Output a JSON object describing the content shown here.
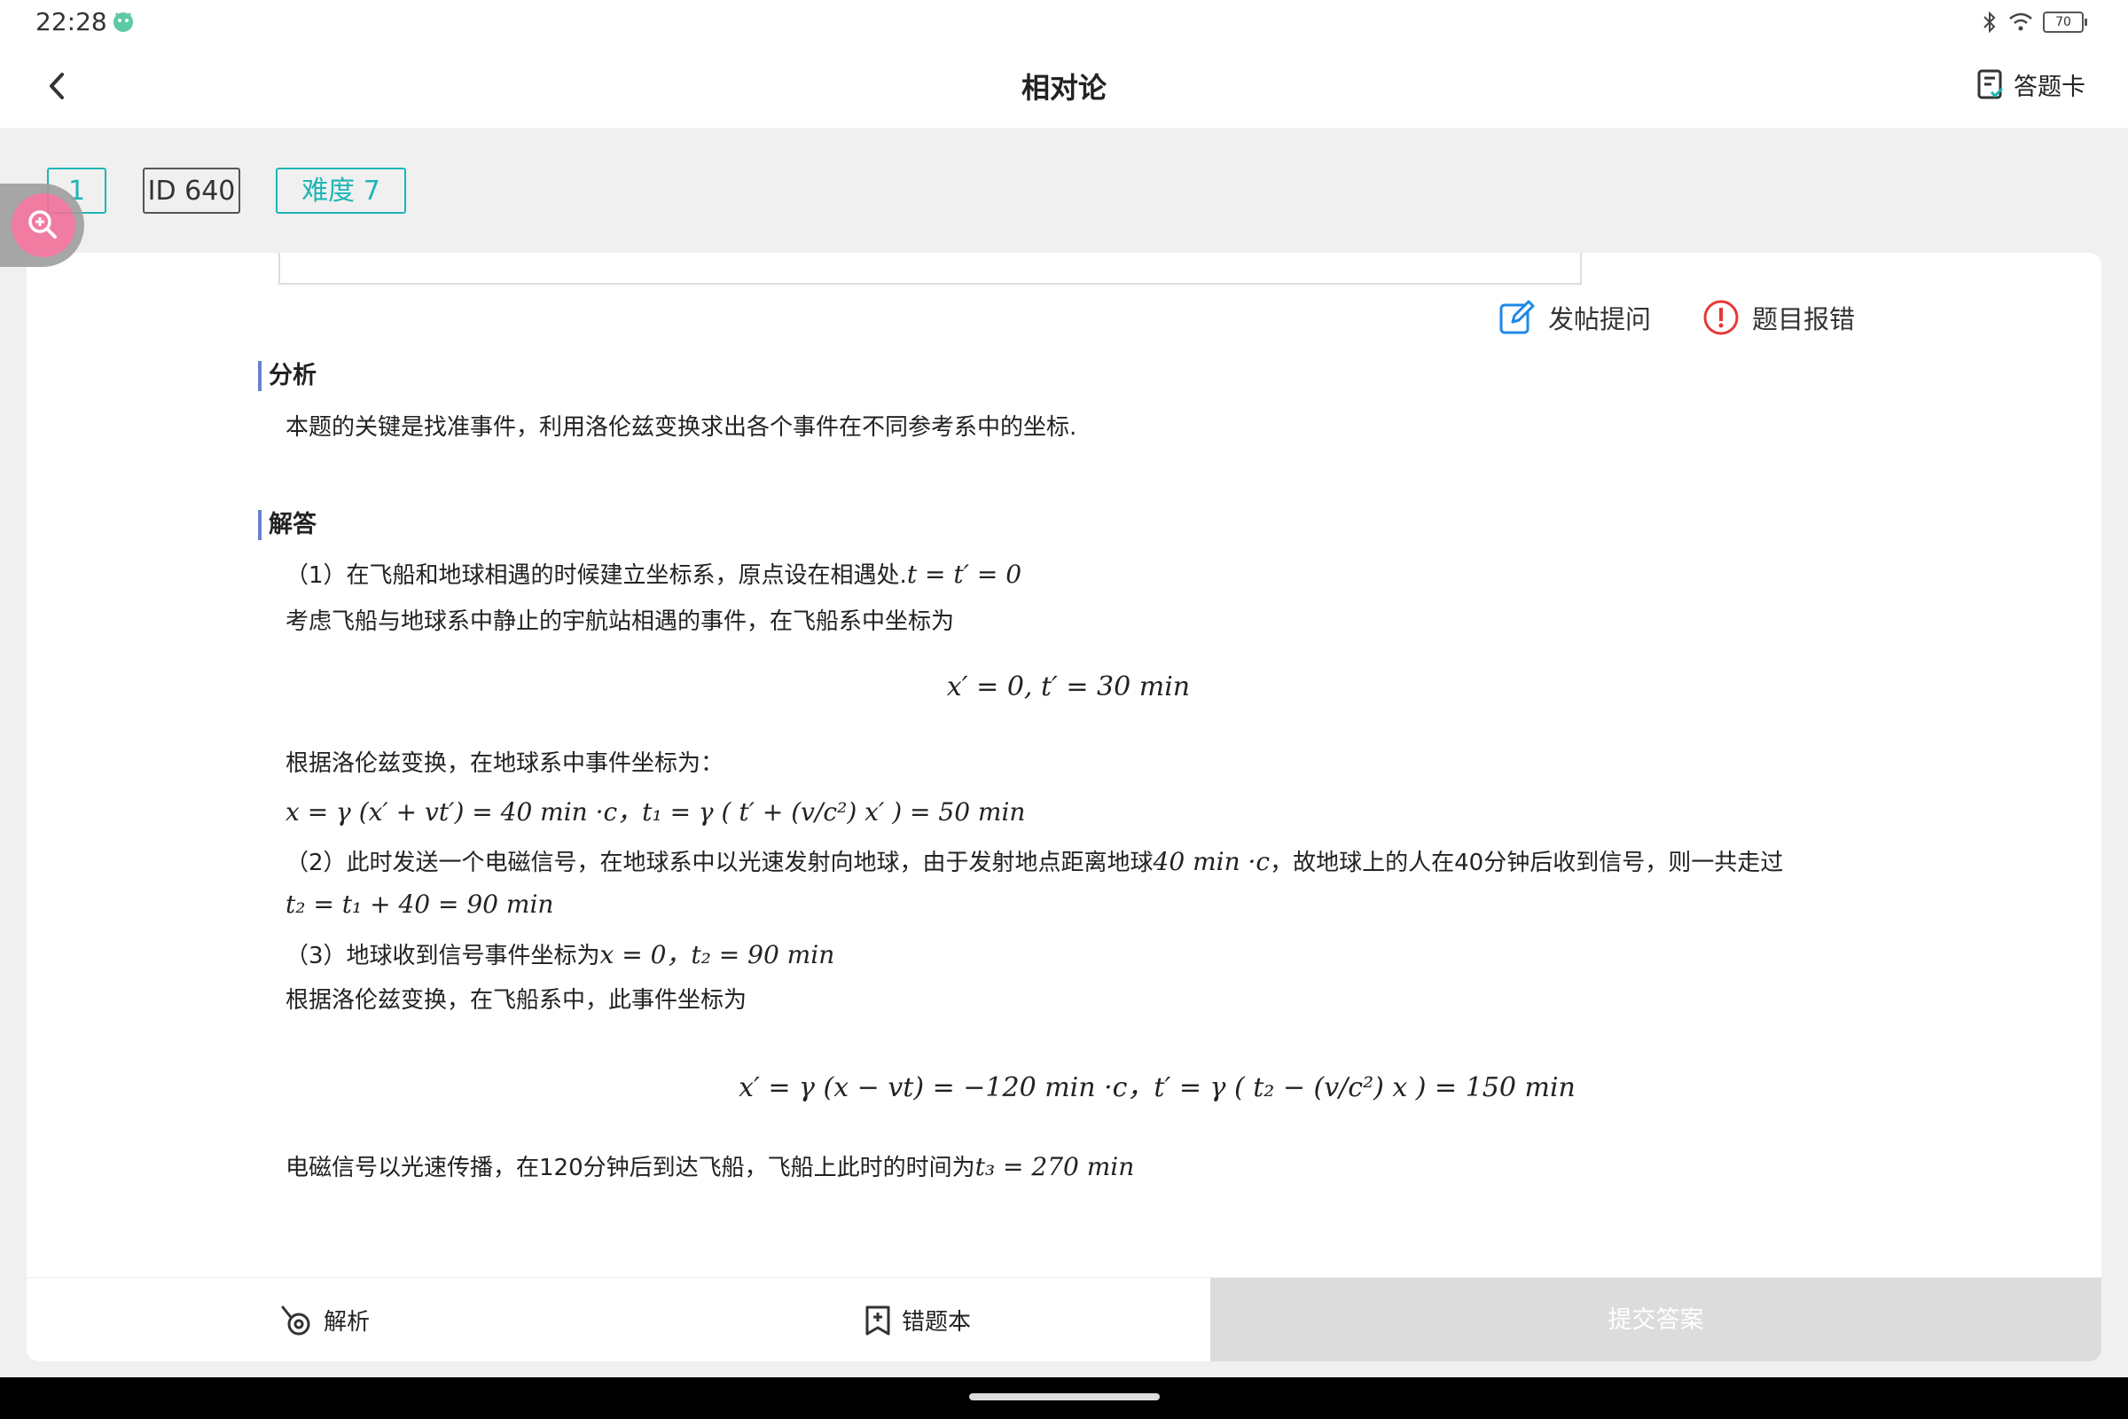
{
  "status": {
    "time": "22:28",
    "battery": "70"
  },
  "nav": {
    "title": "相对论",
    "answer_card": "答题卡"
  },
  "tags": {
    "number": "1",
    "id": "ID 640",
    "difficulty": "难度 7"
  },
  "actions": {
    "ask": "发帖提问",
    "report": "题目报错"
  },
  "analysis": {
    "title": "分析",
    "text": "本题的关键是找准事件，利用洛伦兹变换求出各个事件在不同参考系中的坐标."
  },
  "solution": {
    "title": "解答",
    "l1_text": "（1）在飞船和地球相遇的时候建立坐标系，原点设在相遇处.",
    "l1_math": "t = t′ = 0",
    "l2": "考虑飞船与地球系中静止的宇航站相遇的事件，在飞船系中坐标为",
    "eq1": "x′ = 0, t′ = 30 min",
    "l3": "根据洛伦兹变换，在地球系中事件坐标为：",
    "l4_math": "x = γ (x′ + vt′) = 40 min ·c，t₁ = γ ( t′ + (v/c²) x′ ) = 50 min",
    "l5_text_a": "（2）此时发送一个电磁信号，在地球系中以光速发射向地球，由于发射地点距离地球",
    "l5_math": "40 min ·c",
    "l5_text_b": "，故地球上的人在40分钟后收到信号，则一共走过",
    "l6_math": "t₂ = t₁ + 40 = 90 min",
    "l7_text": "（3）地球收到信号事件坐标为",
    "l7_math": "x = 0，t₂ = 90 min",
    "l8": "根据洛伦兹变换，在飞船系中，此事件坐标为",
    "eq2": "x′ = γ (x − vt) = −120 min ·c，t′ = γ ( t₂ − (v/c²) x ) = 150 min",
    "l9_text": "电磁信号以光速传播，在120分钟后到达飞船，飞船上此时的时间为",
    "l9_math": "t₃ = 270 min"
  },
  "bottom": {
    "analysis": "解析",
    "wrong_book": "错题本",
    "submit": "提交答案"
  },
  "colors": {
    "accent": "#1fb5b5",
    "submit_bg": "#dcdcdc",
    "zoom": "#f0709a",
    "report": "#e53935",
    "ask": "#1e88e5"
  }
}
